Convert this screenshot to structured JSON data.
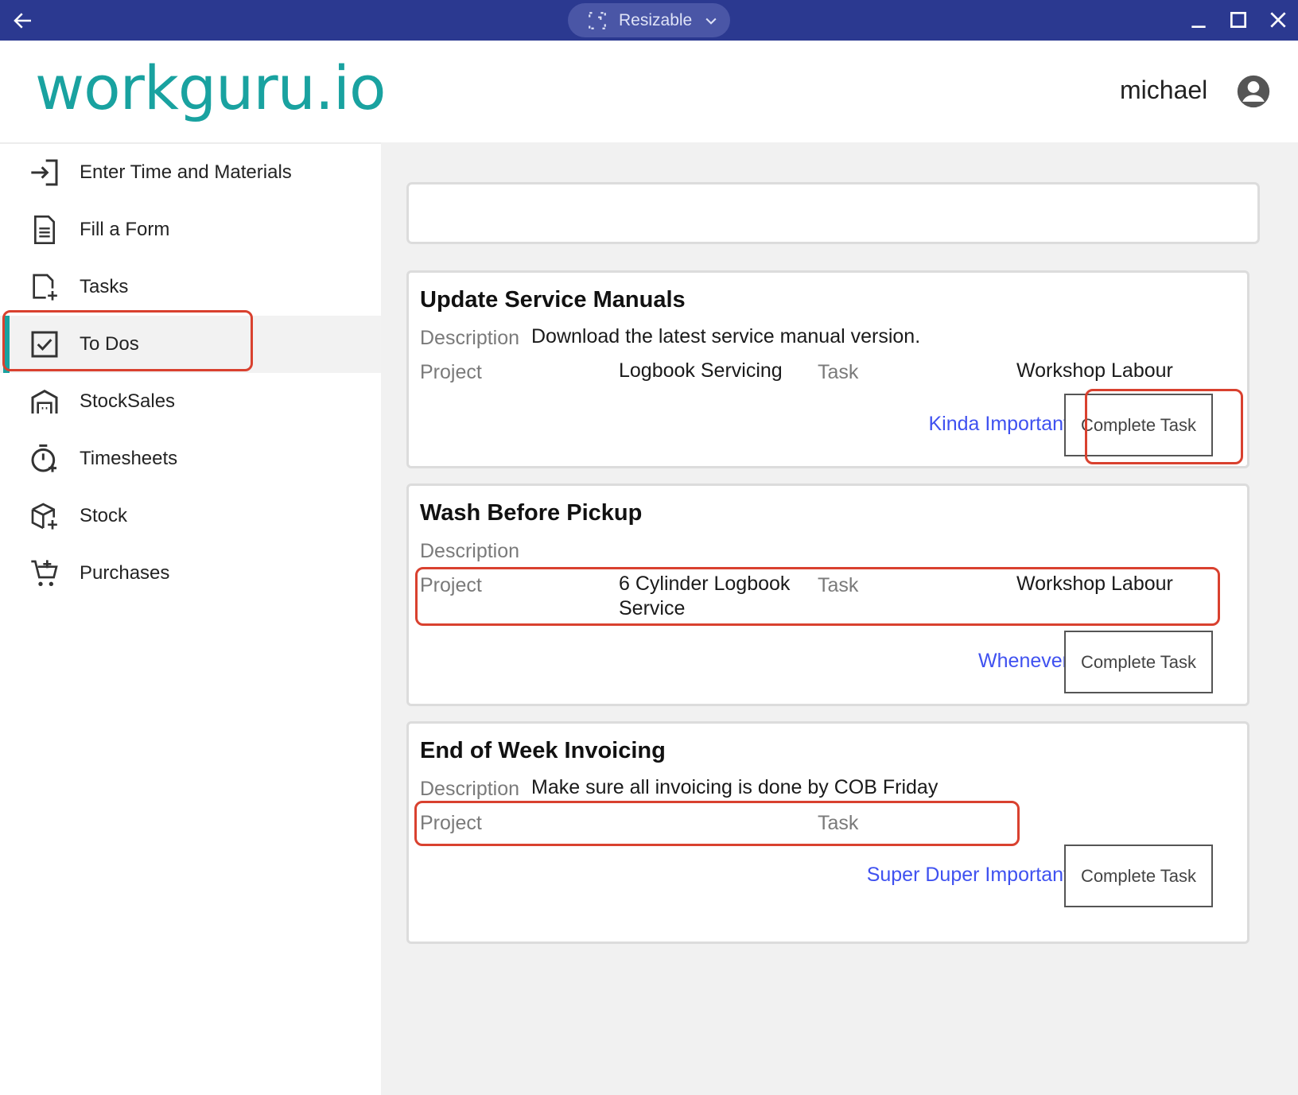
{
  "titlebar": {
    "window_mode": "Resizable",
    "icons": [
      "back-arrow-icon",
      "resize-icon",
      "chevron-down-icon",
      "minimize-icon",
      "maximize-icon",
      "close-icon"
    ]
  },
  "header": {
    "logo": "workguru.io",
    "username": "michael",
    "brand_color": "#19a2a0"
  },
  "sidebar": {
    "items": [
      {
        "label": "Enter Time and Materials",
        "icon": "enter-icon"
      },
      {
        "label": "Fill a Form",
        "icon": "form-document-icon"
      },
      {
        "label": "Tasks",
        "icon": "task-add-icon"
      },
      {
        "label": "To Dos",
        "icon": "checkbox-icon",
        "active": true
      },
      {
        "label": "StockSales",
        "icon": "store-icon"
      },
      {
        "label": "Timesheets",
        "icon": "stopwatch-icon"
      },
      {
        "label": "Stock",
        "icon": "box-add-icon"
      },
      {
        "label": "Purchases",
        "icon": "cart-add-icon"
      }
    ]
  },
  "search": {
    "value": "",
    "placeholder": ""
  },
  "labels": {
    "description": "Description",
    "project": "Project",
    "task": "Task",
    "complete_button": "Complete Task"
  },
  "todos": [
    {
      "title": "Update Service Manuals",
      "description": "Download the latest service manual version.",
      "project": "Logbook Servicing",
      "task": "Workshop Labour",
      "priority": "Kinda Important"
    },
    {
      "title": "Wash Before Pickup",
      "description": "",
      "project": "6 Cylinder Logbook Service",
      "task": "Workshop Labour",
      "priority": "Whenever"
    },
    {
      "title": "End of Week Invoicing",
      "description": "Make sure all invoicing is done by COB Friday",
      "project": "",
      "task": "",
      "priority": "Super Duper Important"
    }
  ],
  "colors": {
    "titlebar": "#2b3990",
    "accent": "#19a2a0",
    "priority_link": "#3f51f0",
    "highlight": "#d9412f"
  }
}
